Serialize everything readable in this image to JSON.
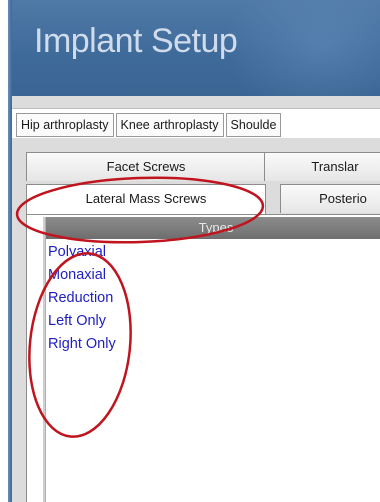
{
  "header": {
    "title": "Implant Setup"
  },
  "categories": [
    {
      "label": "Hip arthroplasty"
    },
    {
      "label": "Knee arthroplasty"
    },
    {
      "label": "Shoulde"
    }
  ],
  "tabs_row1": [
    {
      "label": "Facet Screws"
    },
    {
      "label": "Translar"
    }
  ],
  "tabs_row2": [
    {
      "label": "Lateral Mass Screws",
      "active": true
    },
    {
      "label": "Posterio"
    }
  ],
  "types_panel": {
    "header": "Types",
    "items": [
      {
        "label": "Polyaxial"
      },
      {
        "label": "Monaxial"
      },
      {
        "label": "Reduction"
      },
      {
        "label": "Left Only"
      },
      {
        "label": "Right Only"
      }
    ]
  },
  "colors": {
    "header_bg": "#4f79a6",
    "title_text": "#d0dceb",
    "item_text": "#1f1fc0",
    "annotation_red": "#c0141e"
  }
}
